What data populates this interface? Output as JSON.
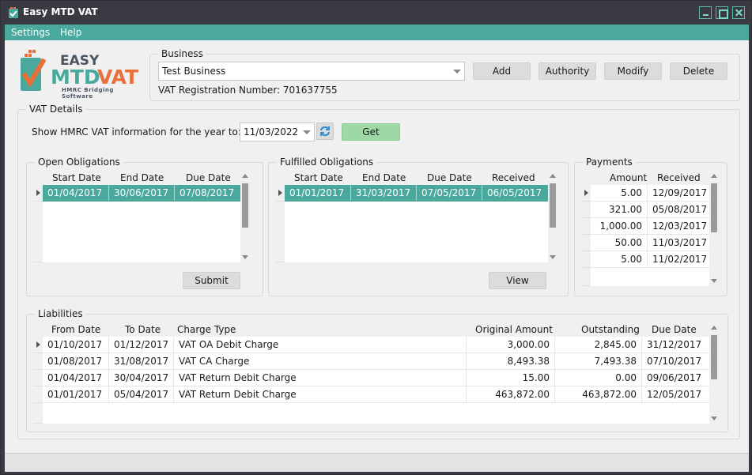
{
  "window": {
    "title": "Easy MTD VAT",
    "accent": "#4aa89c"
  },
  "menu": [
    "Settings",
    "Help"
  ],
  "logo": {
    "top": "EASY",
    "main_a": "MTD",
    "main_b": "VAT",
    "sub": "HMRC Bridging Software"
  },
  "business": {
    "group_label": "Business",
    "selected": "Test Business",
    "vat_reg_label": "VAT Registration Number: 701637755",
    "buttons": {
      "add": "Add",
      "authority": "Authority",
      "modify": "Modify",
      "delete": "Delete"
    }
  },
  "vat_details": {
    "group_label": "VAT Details",
    "show_label": "Show HMRC VAT information for the year to:",
    "date": "11/03/2022",
    "get_label": "Get"
  },
  "open_obligations": {
    "label": "Open Obligations",
    "headers": [
      "Start Date",
      "End Date",
      "Due Date"
    ],
    "rows": [
      [
        "01/04/2017",
        "30/06/2017",
        "07/08/2017"
      ]
    ],
    "submit_label": "Submit"
  },
  "fulfilled_obligations": {
    "label": "Fulfilled Obligations",
    "headers": [
      "Start Date",
      "End Date",
      "Due Date",
      "Received"
    ],
    "rows": [
      [
        "01/01/2017",
        "31/03/2017",
        "07/05/2017",
        "06/05/2017"
      ]
    ],
    "view_label": "View"
  },
  "payments": {
    "label": "Payments",
    "headers": [
      "Amount",
      "Received"
    ],
    "rows": [
      [
        "5.00",
        "12/09/2017"
      ],
      [
        "321.00",
        "05/08/2017"
      ],
      [
        "1,000.00",
        "12/03/2017"
      ],
      [
        "50.00",
        "11/03/2017"
      ],
      [
        "5.00",
        "11/02/2017"
      ]
    ]
  },
  "liabilities": {
    "label": "Liabilities",
    "headers": [
      "From Date",
      "To Date",
      "Charge Type",
      "Original Amount",
      "Outstanding",
      "Due Date"
    ],
    "rows": [
      [
        "01/10/2017",
        "01/12/2017",
        "VAT OA Debit Charge",
        "3,000.00",
        "2,845.00",
        "31/12/2017"
      ],
      [
        "01/08/2017",
        "31/08/2017",
        "VAT CA Charge",
        "8,493.38",
        "7,493.38",
        "07/10/2017"
      ],
      [
        "01/04/2017",
        "30/04/2017",
        "VAT Return Debit Charge",
        "15.00",
        "0.00",
        "09/06/2017"
      ],
      [
        "01/01/2017",
        "05/04/2017",
        "VAT Return Debit Charge",
        "463,872.00",
        "463,872.00",
        "12/05/2017"
      ]
    ]
  }
}
